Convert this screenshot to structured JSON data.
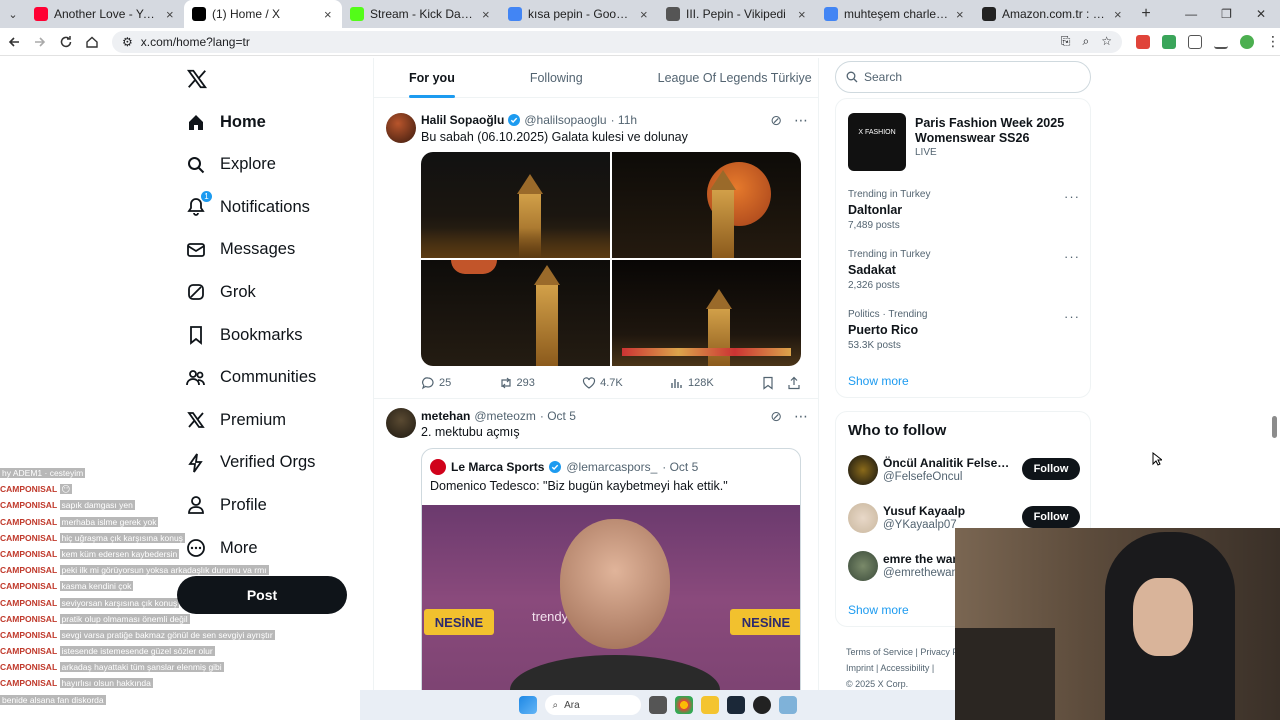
{
  "browser": {
    "tabs": [
      {
        "title": "Another Love - YouTube Mu",
        "icon": "youtube-icon",
        "color": "#ff0033"
      },
      {
        "title": "(1) Home / X",
        "icon": "x-icon",
        "color": "#000000",
        "active": true
      },
      {
        "title": "Stream - Kick Dashboard",
        "icon": "kick-icon",
        "color": "#53fc18"
      },
      {
        "title": "kısa pepin - Google'da Ara",
        "icon": "google-icon",
        "color": "#4285f4"
      },
      {
        "title": "III. Pepin - Vikipedi",
        "icon": "wikipedia-icon",
        "color": "#555555"
      },
      {
        "title": "muhteşem charlemagne kitap",
        "icon": "google-icon",
        "color": "#4285f4"
      },
      {
        "title": "Amazon.com.tr : tarih kitapları",
        "icon": "amazon-icon",
        "color": "#222222"
      }
    ],
    "url": "x.com/home?lang=tr"
  },
  "sidebar": {
    "items": [
      {
        "label": "Home",
        "icon": "home-icon"
      },
      {
        "label": "Explore",
        "icon": "search-icon"
      },
      {
        "label": "Notifications",
        "icon": "bell-icon",
        "badge": "1"
      },
      {
        "label": "Messages",
        "icon": "mail-icon"
      },
      {
        "label": "Grok",
        "icon": "grok-icon"
      },
      {
        "label": "Bookmarks",
        "icon": "bookmark-icon"
      },
      {
        "label": "Communities",
        "icon": "communities-icon"
      },
      {
        "label": "Premium",
        "icon": "x-icon"
      },
      {
        "label": "Verified Orgs",
        "icon": "bolt-icon"
      },
      {
        "label": "Profile",
        "icon": "user-icon"
      },
      {
        "label": "More",
        "icon": "more-circle-icon"
      }
    ],
    "post_label": "Post"
  },
  "feed": {
    "tabs": [
      "For you",
      "Following",
      "League Of Legends Türkiye"
    ],
    "tweets": [
      {
        "name": "Halil Sopaoğlu",
        "handle": "@halilsopaoglu",
        "time": "· 11h",
        "text": "Bu sabah (06.10.2025) Galata kulesi ve dolunay",
        "replies": "25",
        "reposts": "293",
        "likes": "4.7K",
        "views": "128K"
      },
      {
        "name": "metehan",
        "handle": "@meteozm",
        "time": "· Oct 5",
        "text": "2. mektubu açmış",
        "quote": {
          "name": "Le Marca Sports",
          "handle": "@lemarcaspors_",
          "time": "· Oct 5",
          "text": "Domenico Tedesco: \"Biz bugün kaybetmeyi hak ettik.\"",
          "sponsor_text": "NESİNE",
          "sponsor_text_2": "trendyol"
        }
      }
    ]
  },
  "right": {
    "search_placeholder": "Search",
    "live": {
      "thumb_text": "X FASHION",
      "title": "Paris Fashion Week 2025 Womenswear SS26",
      "tag": "LIVE"
    },
    "trends": [
      {
        "context": "Trending in Turkey",
        "name": "Daltonlar",
        "count": "7,489 posts"
      },
      {
        "context": "Trending in Turkey",
        "name": "Sadakat",
        "count": "2,326 posts"
      },
      {
        "context": "Politics · Trending",
        "name": "Puerto Rico",
        "count": "53.3K posts"
      }
    ],
    "show_more": "Show more",
    "who_to_follow": {
      "title": "Who to follow",
      "users": [
        {
          "name": "Öncül Analitik Felsefe ...",
          "handle": "@FelsefeOncul",
          "button": "Follow"
        },
        {
          "name": "Yusuf Kayaalp",
          "handle": "@YKayaalp07",
          "button": "Follow"
        },
        {
          "name": "emre the wan",
          "handle": "@emrethewan"
        }
      ],
      "show_more": "Show more"
    },
    "footer": {
      "line1": "Terms of Service  |  Privacy P",
      "line2": "Imprint  |  Accessibility  |",
      "line3": "© 2025 X Corp."
    }
  },
  "chat": [
    {
      "user": "",
      "msg": "hy ADEM1 · cesteyim"
    },
    {
      "user": "CAMPONISAL",
      "msg": "😶"
    },
    {
      "user": "CAMPONISAL",
      "msg": "sapık damgası yen"
    },
    {
      "user": "CAMPONISAL",
      "msg": "merhaba islme gerek yok"
    },
    {
      "user": "CAMPONISAL",
      "msg": "hiç uğraşma çık karşısına konuş"
    },
    {
      "user": "CAMPONISAL",
      "msg": "kem küm edersen kaybedersin"
    },
    {
      "user": "CAMPONISAL",
      "msg": "peki ilk mi görüyorsun yoksa arkadaşlık durumu va rmı"
    },
    {
      "user": "CAMPONISAL",
      "msg": "kasma kendini çok"
    },
    {
      "user": "CAMPONISAL",
      "msg": "seviyorsan karşısına çık konuş"
    },
    {
      "user": "CAMPONISAL",
      "msg": "pratik olup olmaması önemli değil"
    },
    {
      "user": "CAMPONISAL",
      "msg": "sevgi varsa pratiğe bakmaz gönül de sen sevgiyi ayrıştır"
    },
    {
      "user": "CAMPONISAL",
      "msg": "istesende istemesende güzel sözler olur"
    },
    {
      "user": "CAMPONISAL",
      "msg": "arkadaş hayattaki tüm şanslar elenmiş gibi"
    },
    {
      "user": "CAMPONISAL",
      "msg": "hayırlısı olsun hakkında"
    },
    {
      "user": "",
      "msg": "benide alsana fan diskorda"
    }
  ],
  "taskbar": {
    "search_label": "Ara"
  }
}
